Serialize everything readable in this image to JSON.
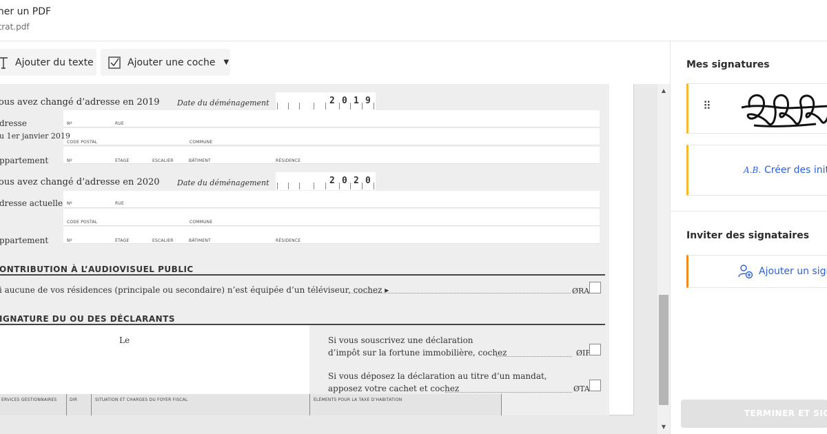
{
  "header": {
    "title": "gner un PDF",
    "file": "ntrat.pdf"
  },
  "toolbar": {
    "add_text": "Ajouter du texte",
    "add_check": "Ajouter une coche"
  },
  "form": {
    "section2019": {
      "heading": "ous avez changé d’adresse en 2019",
      "date_label": "Date du déménagement",
      "year_digits": [
        "2",
        "0",
        "1",
        "9"
      ],
      "row1_label": "dresse",
      "row2_label": "u 1er janvier 2019",
      "row3_label": "ppartement"
    },
    "section2020": {
      "heading": "ous avez changé d’adresse en 2020",
      "date_label": "Date du déménagement",
      "year_digits": [
        "2",
        "0",
        "2",
        "0"
      ],
      "row1_label": "dresse actuelle",
      "row3_label": "ppartement"
    },
    "fields": {
      "no": "Nº",
      "rue": "RUE",
      "code_postal": "CODE POSTAL",
      "commune": "COMMUNE",
      "etage": "ÉTAGE",
      "escalier": "ESCALIER",
      "batiment": "BÂTIMENT",
      "residence": "RÉSIDENCE"
    },
    "audiovisuel": {
      "heading": "ONTRIBUTION À L’AUDIOVISUEL PUBLIC",
      "text": "i aucune de vos résidences (principale ou secondaire) n’est équipée d’un téléviseur, cochez ▸",
      "code": "ØRA"
    },
    "signature": {
      "heading": "IGNATURE DU OU DES DÉCLARANTS",
      "le": "Le",
      "ifi_line1": "Si vous souscrivez une déclaration",
      "ifi_line2": "d’impôt sur la fortune immobilière, cochez",
      "ifi_code": "ØIF",
      "mandat_line1": "Si vous déposez la déclaration au titre d’un mandat,",
      "mandat_line2": "apposez votre cachet et cochez",
      "mandat_code": "ØTA"
    },
    "footer_cols": {
      "services": "ERVICES GESTIONNAIRES",
      "dir": "DIR",
      "situation": "SITUATION ET CHARGES DU FOYER FISCAL",
      "elements": "ÉLÉMENTS POUR LA TAXE D’HABITATION"
    }
  },
  "panel": {
    "my_signatures": "Mes signatures",
    "initials_mark": "A.B.",
    "create_initials": "Créer des initia",
    "invite_heading": "Inviter des signataires",
    "add_signer": "Ajouter un signa",
    "finish": "TERMINER ET SIGN"
  },
  "colors": {
    "accent_blue": "#2d5fdc",
    "signature_stripe": "#f5b82e",
    "invite_stripe": "#f28a1e",
    "finish_disabled": "#e1e1e1"
  }
}
